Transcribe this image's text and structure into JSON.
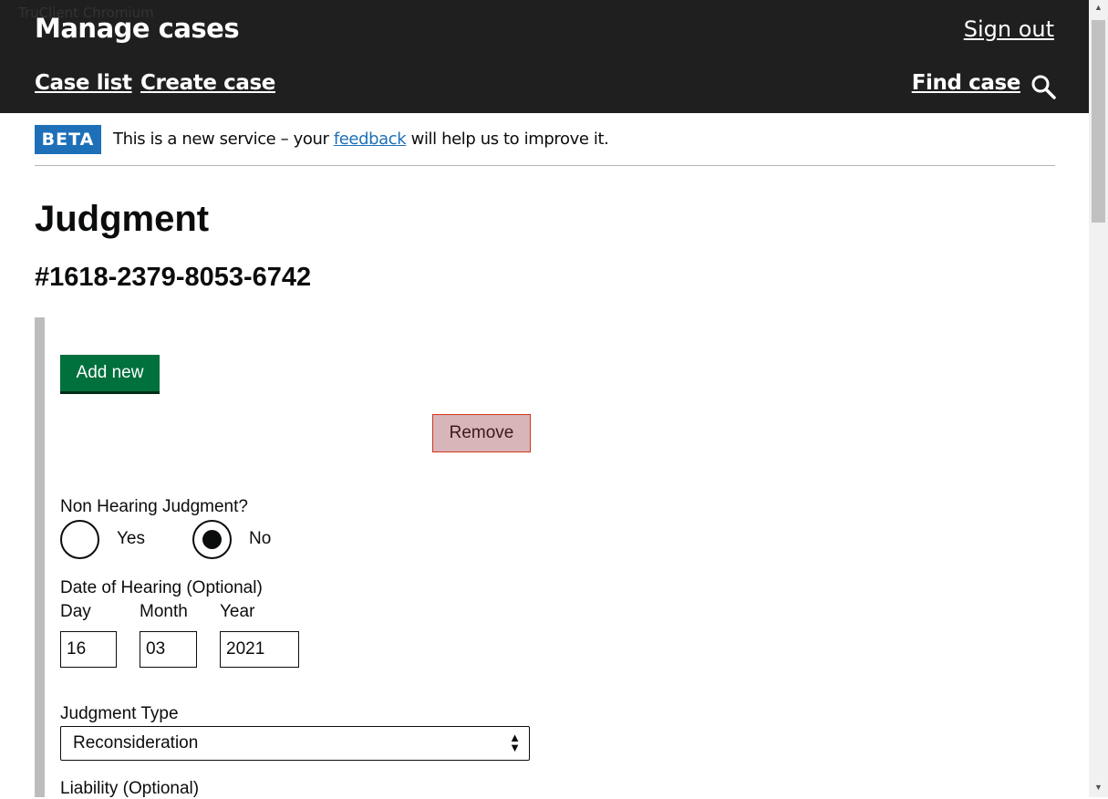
{
  "watermark": "TruClient Chromium",
  "header": {
    "service_name": "Manage cases",
    "sign_out": "Sign out",
    "nav": {
      "case_list": "Case list",
      "create_case": "Create case",
      "find_case": "Find case"
    },
    "search_icon": "search-icon"
  },
  "phase_banner": {
    "tag": "BETA",
    "text_before": "This is a new service – your ",
    "link": "feedback",
    "text_after": " will help us to improve it."
  },
  "page": {
    "title": "Judgment",
    "case_number": "#1618-2379-8053-6742"
  },
  "form": {
    "add_new_label": "Add new",
    "remove_label": "Remove",
    "non_hearing": {
      "label": "Non Hearing Judgment?",
      "options": [
        "Yes",
        "No"
      ],
      "selected": "No"
    },
    "date_of_hearing": {
      "label": "Date of Hearing (Optional)",
      "day_label": "Day",
      "month_label": "Month",
      "year_label": "Year",
      "day": "16",
      "month": "03",
      "year": "2021"
    },
    "judgment_type": {
      "label": "Judgment Type",
      "selected": "Reconsideration"
    },
    "liability": {
      "label": "Liability (Optional)"
    }
  },
  "colors": {
    "header_bg": "#1f1f1f",
    "beta_tag": "#1d70b8",
    "add_button": "#00703c",
    "remove_button": "#d7b5b9"
  }
}
